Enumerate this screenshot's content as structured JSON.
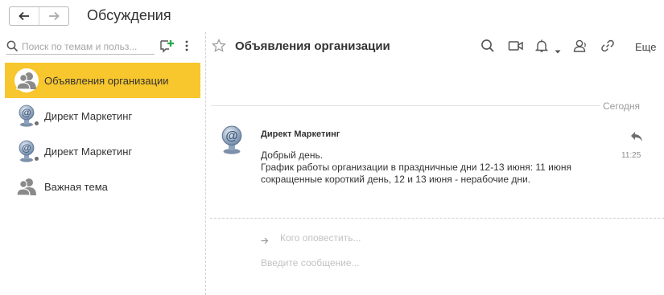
{
  "header": {
    "title": "Обсуждения"
  },
  "sidebar": {
    "search_placeholder": "Поиск по темам и польз...",
    "topics": [
      {
        "label": "Объявления организации",
        "icon": "group-icon",
        "active": true
      },
      {
        "label": "Директ Маркетинг",
        "icon": "at-sign-avatar-icon",
        "active": false
      },
      {
        "label": "Директ Маркетинг",
        "icon": "at-sign-avatar-icon",
        "active": false
      },
      {
        "label": "Важная тема",
        "icon": "group-icon",
        "active": false
      }
    ]
  },
  "conversation": {
    "title": "Объявления организации",
    "more_label": "Еще",
    "date_label": "Сегодня",
    "message": {
      "author": "Директ Маркетинг",
      "time": "11:25",
      "lines": [
        "Добрый день.",
        "График работы организации в праздничные дни 12-13 июня: 11 июня",
        "сокращенные короткий день, 12 и 13 июня - нерабочие дни."
      ]
    },
    "compose": {
      "notify_placeholder": "Кого оповестить...",
      "message_placeholder": "Введите сообщение..."
    }
  },
  "colors": {
    "active_topic": "#f8c62d",
    "icon_gray": "#8a8a8a",
    "add_green": "#2aa84a"
  }
}
